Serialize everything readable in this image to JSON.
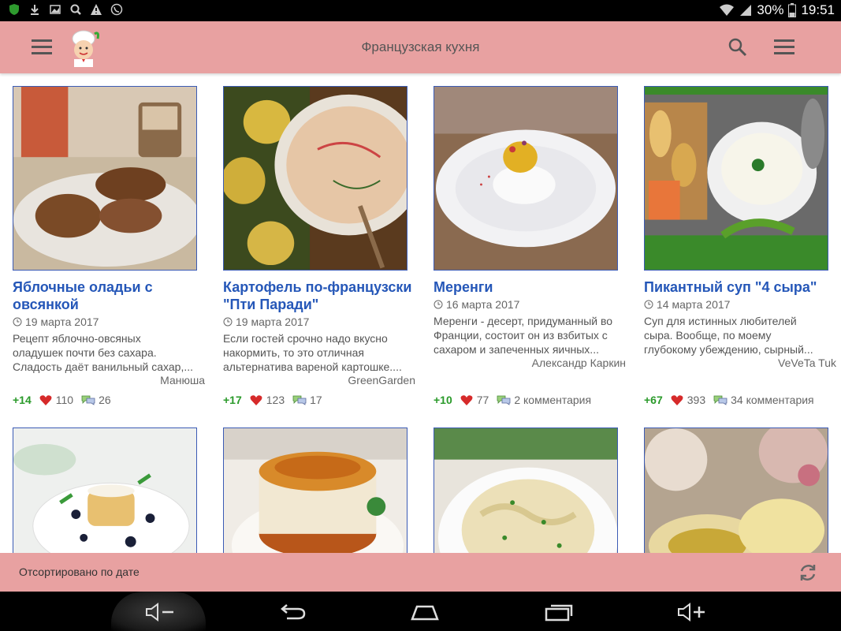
{
  "status_bar": {
    "battery": "30%",
    "time": "19:51"
  },
  "app_bar": {
    "title": "Французская кухня"
  },
  "cards": [
    {
      "title_lines": [
        "Яблочные оладьи с",
        "овсянкой"
      ],
      "date": "19 марта 2017",
      "desc_lines": [
        "Рецепт яблочно-овсяных",
        "оладушек почти без сахара.",
        "Сладость даёт ванильный сахар,..."
      ],
      "author": "Манюша",
      "rating": "+14",
      "likes": "110",
      "comments": "26"
    },
    {
      "title_lines": [
        "Картофель по-французски",
        "\"Пти Паради\""
      ],
      "date": "19 марта 2017",
      "desc_lines": [
        "Если гостей срочно надо вкусно",
        "накормить, то это отличная",
        "альтернатива вареной картошке...."
      ],
      "author": "GreenGarden",
      "rating": "+17",
      "likes": "123",
      "comments": "17"
    },
    {
      "title_lines": [
        "Меренги"
      ],
      "date": "16 марта 2017",
      "desc_lines": [
        "Меренги - десерт, придуманный во",
        "Франции, состоит он из взбитых с",
        "сахаром и запеченных яичных..."
      ],
      "author": "Александр Каркин",
      "rating": "+10",
      "likes": "77",
      "comments": "2 комментария"
    },
    {
      "title_lines": [
        "Пикантный суп \"4 сыра\""
      ],
      "date": "14 марта 2017",
      "desc_lines": [
        "Суп для истинных любителей",
        "сыра. Вообще, по моему",
        "глубокому убеждению, сырный..."
      ],
      "author": "VeVeTa Tuk",
      "rating": "+67",
      "likes": "393",
      "comments": "34 комментария"
    }
  ],
  "bottom_bar": {
    "sort_label": "Отсортировано по дате"
  }
}
